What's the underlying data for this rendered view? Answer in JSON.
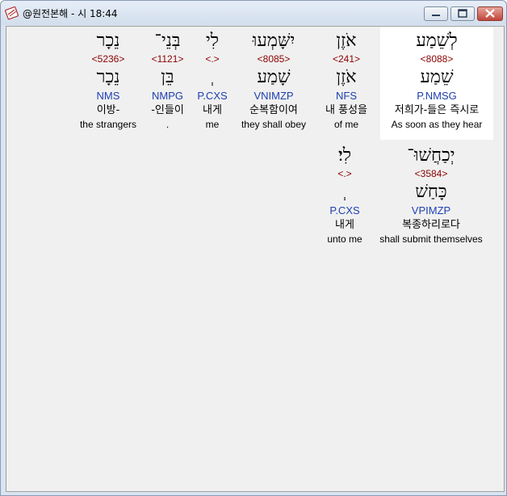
{
  "window": {
    "title": "@원전본해 - 시 18:44"
  },
  "verse_line1": [
    {
      "hebrew": "נֵכָר",
      "strong": "<5236>",
      "lexeme": "נֵכָר",
      "parse": "NMS",
      "korean": "이방-",
      "english": "the strangers"
    },
    {
      "hebrew": "בְּנֵי־",
      "strong": "<1121>",
      "lexeme": "בֵּן",
      "parse": "NMPG",
      "korean": "-인들이",
      "english": "."
    },
    {
      "hebrew": "לִי",
      "strong": "<.>",
      "lexeme": "ְ",
      "parse": "P.CXS",
      "korean": "내게",
      "english": "me"
    },
    {
      "hebrew": "יִשָּׁמְעוּ",
      "strong": "<8085>",
      "lexeme": "שָׁמַע",
      "parse": "VNIMZP",
      "korean": "순복함이여",
      "english": "they shall obey"
    },
    {
      "hebrew": "אֹזֶן",
      "strong": "<241>",
      "lexeme": "אֹזֶן",
      "parse": "NFS",
      "korean": "내 풍성을",
      "english": "of me"
    },
    {
      "hebrew": "לְשֵׁמַע",
      "strong": "<8088>",
      "lexeme": "שֵׁמַע",
      "parse": "P.NMSG",
      "korean": "저희가-들은 즉시로",
      "english": "As soon as they hear"
    }
  ],
  "verse_line2": [
    {
      "hebrew": "לִי׃",
      "strong": "<.>",
      "lexeme": "ְ",
      "parse": "P.CXS",
      "korean": "내게",
      "english": "unto me"
    },
    {
      "hebrew": "יְכַחֲשׁוּ־",
      "strong": "<3584>",
      "lexeme": "כָּחַשׁ",
      "parse": "VPIMZP",
      "korean": "복종하리로다",
      "english": "shall submit themselves"
    }
  ]
}
